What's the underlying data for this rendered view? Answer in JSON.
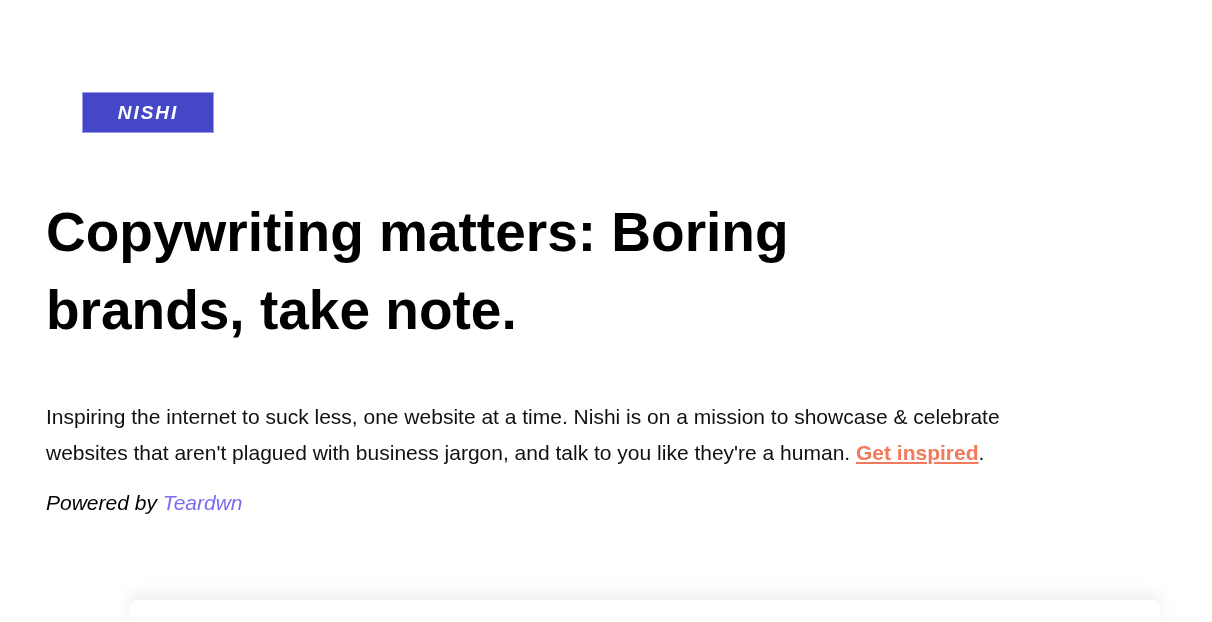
{
  "logo": {
    "text": "NISHI"
  },
  "heading": "Copywriting matters: Boring brands, take note.",
  "intro": {
    "text": "Inspiring the internet to suck less, one website at a time. Nishi is on a mission to showcase & celebrate websites that aren't plagued with business jargon, and talk to you like they're a human. ",
    "link": "Get inspired",
    "end": "."
  },
  "credit": {
    "text": "Powered by ",
    "link": "Teardwn"
  },
  "card": {
    "kind": "card"
  }
}
